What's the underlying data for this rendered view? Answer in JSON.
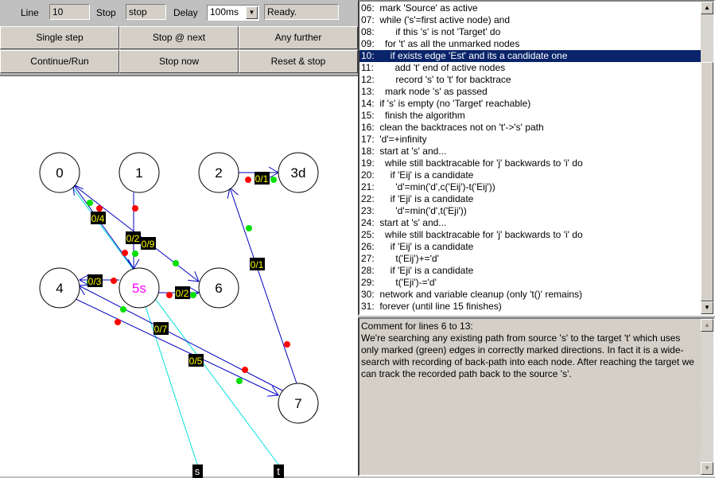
{
  "toolbar": {
    "line_label": "Line",
    "line_value": "10",
    "stop_label": "Stop",
    "stop_value": "stop",
    "delay_label": "Delay",
    "delay_value": "100ms",
    "status": "Ready."
  },
  "buttons": {
    "single_step": "Single step",
    "stop_at_next": "Stop @ next",
    "any_further": "Any further",
    "continue_run": "Continue/Run",
    "stop_now": "Stop now",
    "reset_stop": "Reset & stop"
  },
  "code": {
    "selected_line": "10",
    "lines": [
      {
        "num": "06:",
        "text": "  mark 'Source' as active"
      },
      {
        "num": "07:",
        "text": "  while ('s'=first active node) and"
      },
      {
        "num": "08:",
        "text": "        if this 's' is not 'Target' do"
      },
      {
        "num": "09:",
        "text": "    for 't' as all the unmarked nodes"
      },
      {
        "num": "10:",
        "text": "      if exists edge 'Est' and its a candidate one"
      },
      {
        "num": "11:",
        "text": "        add 't' end of active nodes"
      },
      {
        "num": "12:",
        "text": "        record 's' to 't' for backtrace"
      },
      {
        "num": "13:",
        "text": "    mark node 's' as passed"
      },
      {
        "num": "14:",
        "text": "  if 's' is empty (no 'Target' reachable)"
      },
      {
        "num": "15:",
        "text": "    finish the algorithm"
      },
      {
        "num": "16:",
        "text": "  clean the backtraces not on 't'->'s' path"
      },
      {
        "num": "17:",
        "text": "  'd'=+infinity"
      },
      {
        "num": "18:",
        "text": "  start at 's' and..."
      },
      {
        "num": "19:",
        "text": "    while still backtracable for 'j' backwards to 'i' do"
      },
      {
        "num": "20:",
        "text": "      if 'Eij' is a candidate"
      },
      {
        "num": "21:",
        "text": "        'd'=min('d',c('Eij')-t('Eij'))"
      },
      {
        "num": "22:",
        "text": "      if 'Eji' is a candidate"
      },
      {
        "num": "23:",
        "text": "        'd'=min('d',t('Eji'))"
      },
      {
        "num": "24:",
        "text": "  start at 's' and..."
      },
      {
        "num": "25:",
        "text": "    while still backtracable for 'j' backwards to 'i' do"
      },
      {
        "num": "26:",
        "text": "      if 'Eij' is a candidate"
      },
      {
        "num": "27:",
        "text": "        t('Eij')+='d'"
      },
      {
        "num": "28:",
        "text": "      if 'Eji' is a candidate"
      },
      {
        "num": "29:",
        "text": "        t('Eji')-='d'"
      },
      {
        "num": "30:",
        "text": "  network and variable cleanup (only 't()' remains)"
      },
      {
        "num": "31:",
        "text": "  forever (until line 15 finishes)"
      }
    ]
  },
  "comment": {
    "title": "Comment for lines 6 to 13:",
    "body": "We're searching any existing path from source 's' to the target 't' which uses only marked (green) edges in correctly marked directions. In fact it is a wide-search with recording of back-path into each node. After reaching the target we can track the recorded path back to the source 's'."
  },
  "graph": {
    "colors": {
      "edge": "#0000c0",
      "pointer": "#00e0e0",
      "source_label": "#ff00ff",
      "flow_text": "#ffff00",
      "red_dot": "#ff0000",
      "green_dot": "#00e000"
    },
    "nodes": [
      {
        "id": "0",
        "label": "0"
      },
      {
        "id": "1",
        "label": "1"
      },
      {
        "id": "2",
        "label": "2"
      },
      {
        "id": "3",
        "label": "3d"
      },
      {
        "id": "4",
        "label": "4"
      },
      {
        "id": "5",
        "label": "5s",
        "source": true
      },
      {
        "id": "6",
        "label": "6"
      },
      {
        "id": "7",
        "label": "7"
      }
    ],
    "edges": [
      {
        "from": "1",
        "to": "5",
        "flow": "0/2"
      },
      {
        "from": "5",
        "to": "0",
        "flow": "0/4"
      },
      {
        "from": "0",
        "to": "6",
        "flow": "0/9"
      },
      {
        "from": "5",
        "to": "4",
        "flow": "0/3"
      },
      {
        "from": "5",
        "to": "6",
        "flow": "0/2"
      },
      {
        "from": "2",
        "to": "3",
        "flow": "0/1"
      },
      {
        "from": "7",
        "to": "2",
        "flow": "0/1"
      },
      {
        "from": "7",
        "to": "4",
        "flow": "0/7"
      },
      {
        "from": "4",
        "to": "7",
        "flow": "0/5"
      }
    ],
    "pointers": [
      {
        "label": "s",
        "target": "5"
      },
      {
        "label": "t",
        "target": "0"
      }
    ]
  }
}
